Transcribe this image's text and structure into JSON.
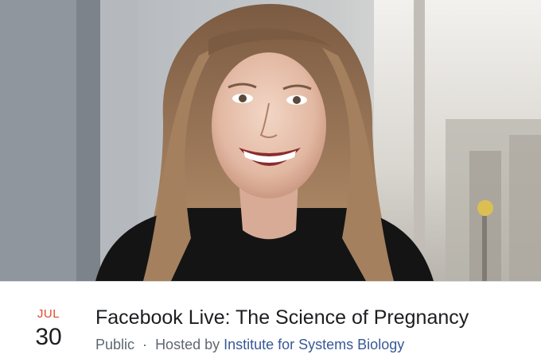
{
  "event": {
    "cover_photo": "portrait-photo-smiling-woman",
    "date": {
      "month": "JUL",
      "day": "30"
    },
    "title": "Facebook Live: The Science of Pregnancy",
    "privacy": "Public",
    "separator": "·",
    "hosted_by_label": "Hosted by",
    "host_name": "Institute for Systems Biology"
  },
  "colors": {
    "month_accent": "#e0472f",
    "link": "#385898",
    "meta_text": "#606770",
    "title_text": "#1c1e21"
  }
}
